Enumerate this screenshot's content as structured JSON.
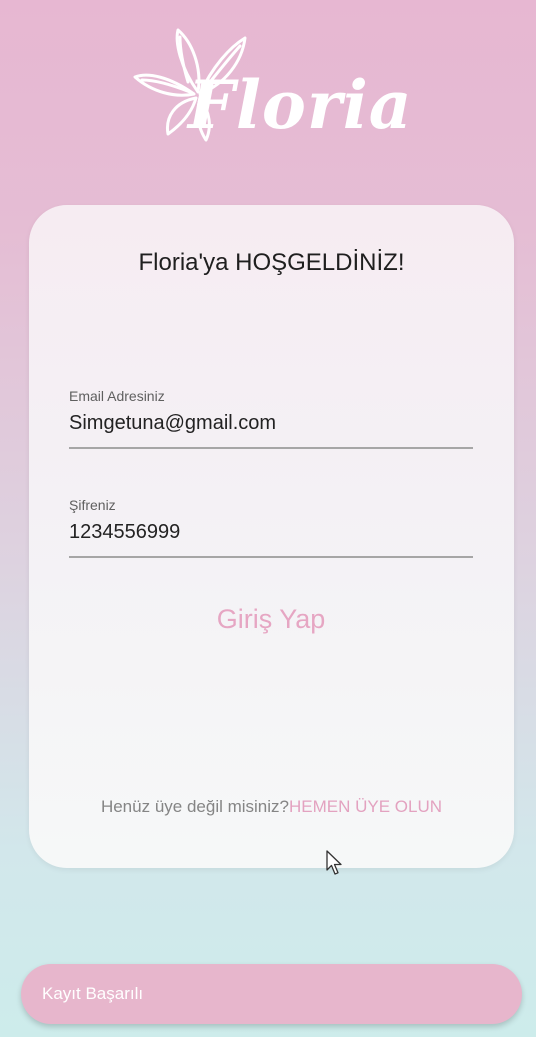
{
  "logo": {
    "icon": "flower-icon",
    "text": "Floria"
  },
  "login_card": {
    "welcome_title": "Floria'ya HOŞGELDİNİZ!",
    "email": {
      "label": "Email Adresiniz",
      "value": "Simgetuna@gmail.com"
    },
    "password": {
      "label": "Şifreniz",
      "value": "1234556999"
    },
    "login_button": "Giriş Yap",
    "signup_question": "Henüz üye değil misiniz?",
    "signup_link": "HEMEN ÜYE OLUN"
  },
  "toast": {
    "message": "Kayıt Başarılı"
  },
  "colors": {
    "background_top": "#e7b7d2",
    "background_bottom": "#cdeceb",
    "accent_pink": "#e3a2c0",
    "toast_bg": "#e7b6cc",
    "card_bg": "#f4f1f5"
  }
}
